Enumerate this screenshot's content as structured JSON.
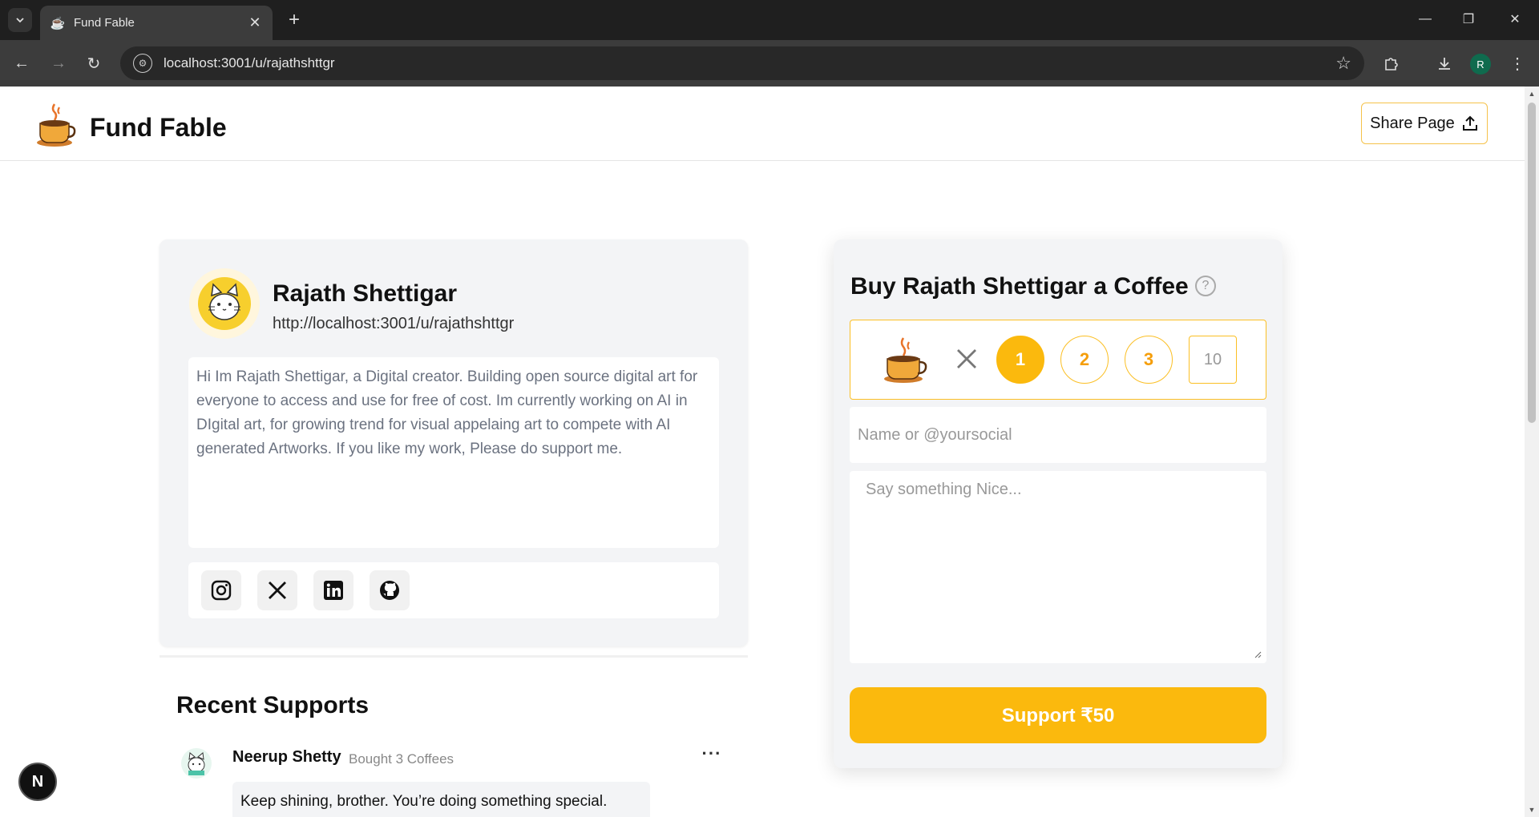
{
  "browser": {
    "tab_title": "Fund Fable",
    "url": "localhost:3001/u/rajathshttgr",
    "profile_initial": "R"
  },
  "header": {
    "logo_text": "Fund Fable",
    "share_label": "Share Page"
  },
  "profile": {
    "name": "Rajath Shettigar",
    "url": "http://localhost:3001/u/rajathshttgr",
    "bio": "Hi Im Rajath Shettigar, a Digital creator. Building open source digital art for everyone to access and use for free of cost. Im currently working on AI in DIgital art, for growing trend for visual appelaing art to compete with AI generated Artworks. If you like my work, Please do support me.",
    "socials": [
      "instagram-icon",
      "x-icon",
      "linkedin-icon",
      "github-icon"
    ]
  },
  "recent": {
    "title": "Recent Supports",
    "items": [
      {
        "name": "Neerup Shetty",
        "meta": "Bought 3 Coffees",
        "message": "Keep shining, brother. You’re doing something special."
      }
    ]
  },
  "buy": {
    "title": "Buy Rajath Shettigar a Coffee",
    "help": "?",
    "quantities": [
      "1",
      "2",
      "3"
    ],
    "selected": "1",
    "custom_qty": "10",
    "name_placeholder": "Name or @yoursocial",
    "message_placeholder": "Say something Nice...",
    "support_label": "Support ₹50"
  },
  "devtools": {
    "badge": "N"
  },
  "colors": {
    "accent": "#fbb90d",
    "accent_border": "#fbbf24",
    "card_bg": "#f3f4f6"
  }
}
